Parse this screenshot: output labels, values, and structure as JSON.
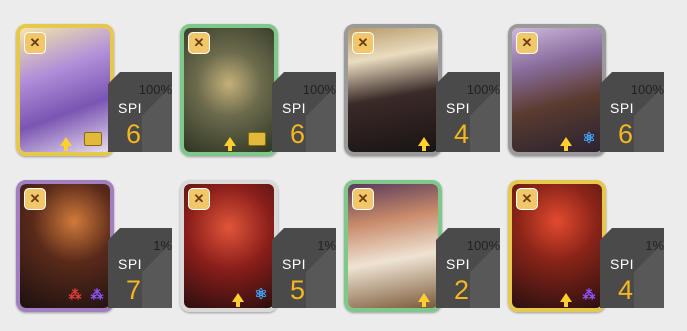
{
  "cards": [
    {
      "percent": "100%",
      "spi_label": "SPI",
      "spi_value": "6",
      "frame": "gold",
      "bg": "#8f6db8",
      "accent": "#f1e38a",
      "icons": [
        "arrow-up",
        "tag"
      ]
    },
    {
      "percent": "100%",
      "spi_label": "SPI",
      "spi_value": "6",
      "frame": "green",
      "bg": "#4a5a3a",
      "accent": "#c4b07a",
      "icons": [
        "arrow-up",
        "tag"
      ]
    },
    {
      "percent": "100%",
      "spi_label": "SPI",
      "spi_value": "4",
      "frame": "grey",
      "bg": "#2c2424",
      "accent": "#d6c08b",
      "icons": [
        "arrow-up"
      ]
    },
    {
      "percent": "100%",
      "spi_label": "SPI",
      "spi_value": "6",
      "frame": "grey",
      "bg": "#3b2e44",
      "accent": "#c79c5a",
      "icons": [
        "arrow-up",
        "atom"
      ]
    },
    {
      "percent": "1%",
      "spi_label": "SPI",
      "spi_value": "7",
      "frame": "purple",
      "bg": "#2b1a16",
      "accent": "#c06a3a",
      "icons": [
        "triangle-red",
        "triangle-purple"
      ]
    },
    {
      "percent": "1%",
      "spi_label": "SPI",
      "spi_value": "5",
      "frame": "white",
      "bg": "#5a1714",
      "accent": "#d64a2a",
      "icons": [
        "arrow-up",
        "atom"
      ]
    },
    {
      "percent": "100%",
      "spi_label": "SPI",
      "spi_value": "2",
      "frame": "green",
      "bg": "#3a2a2a",
      "accent": "#e8dcc8",
      "icons": [
        "arrow-up"
      ]
    },
    {
      "percent": "1%",
      "spi_label": "SPI",
      "spi_value": "4",
      "frame": "gold",
      "bg": "#3d1a1a",
      "accent": "#e24a2f",
      "icons": [
        "arrow-up",
        "triangle-purple"
      ]
    }
  ]
}
